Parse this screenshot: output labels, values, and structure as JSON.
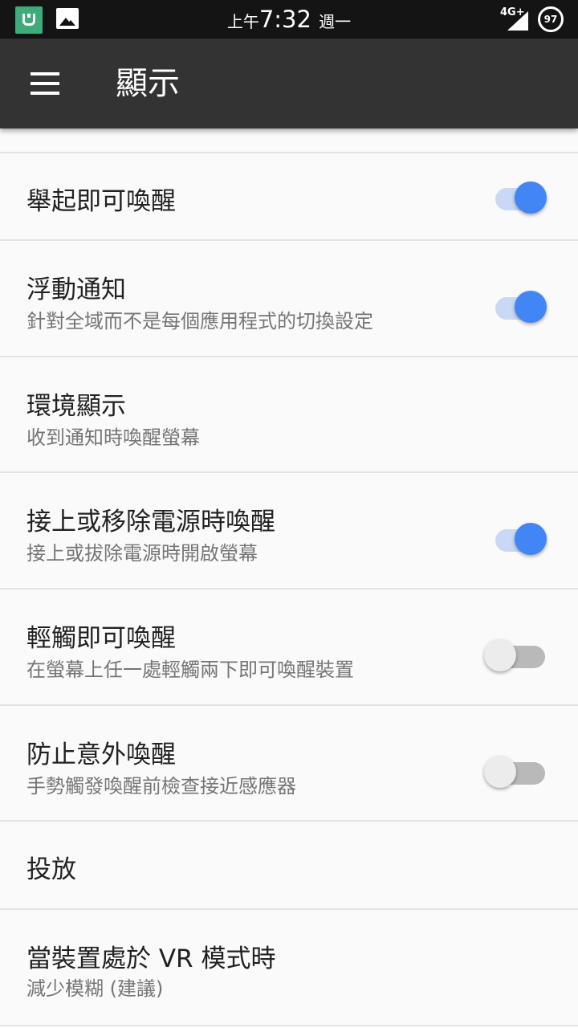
{
  "status_bar": {
    "ampm": "上午",
    "time": "7:32",
    "weekday": "週一",
    "network": "4G+",
    "battery": "97"
  },
  "app_bar": {
    "title": "顯示",
    "menu_icon": "hamburger-menu-icon"
  },
  "settings": [
    {
      "title": "舉起即可喚醒",
      "summary": "",
      "toggle": true
    },
    {
      "title": "浮動通知",
      "summary": "針對全域而不是每個應用程式的切換設定",
      "toggle": true
    },
    {
      "title": "環境顯示",
      "summary": "收到通知時喚醒螢幕",
      "toggle": null
    },
    {
      "title": "接上或移除電源時喚醒",
      "summary": "接上或拔除電源時開啟螢幕",
      "toggle": true
    },
    {
      "title": "輕觸即可喚醒",
      "summary": "在螢幕上任一處輕觸兩下即可喚醒裝置",
      "toggle": false
    },
    {
      "title": "防止意外喚醒",
      "summary": "手勢觸發喚醒前檢查接近感應器",
      "toggle": false
    },
    {
      "title": "投放",
      "summary": "",
      "toggle": null
    },
    {
      "title": "當裝置處於 VR 模式時",
      "summary": "減少模糊 (建議)",
      "toggle": null
    }
  ],
  "colors": {
    "accent": "#4285f4",
    "app_bar": "#333333",
    "status_bar": "#141414"
  }
}
